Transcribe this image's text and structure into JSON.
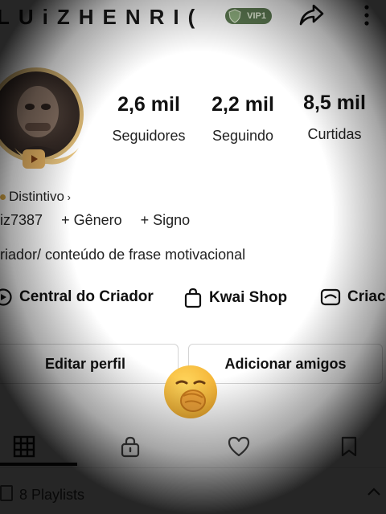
{
  "header": {
    "profile_name": "LUiZHENRI(",
    "vip_label": "VIP1"
  },
  "stats": [
    {
      "value": "2,6 mil",
      "label": "Seguidores"
    },
    {
      "value": "2,2 mil",
      "label": "Seguindo"
    },
    {
      "value": "8,5 mil",
      "label": "Curtidas"
    }
  ],
  "profile": {
    "badge_label": "Distintivo",
    "user_id": "iz7387",
    "gender_label": "+ Gênero",
    "sign_label": "+ Signo",
    "bio": "riador/ conteúdo de frase motivacional"
  },
  "shortcuts": [
    {
      "label": "Central do Criador",
      "icon": "creator-center-icon"
    },
    {
      "label": "Kwai Shop",
      "icon": "shopping-bag-icon"
    },
    {
      "label": "Criac",
      "icon": "create-icon"
    }
  ],
  "buttons": {
    "edit_profile": "Editar perfil",
    "add_friends": "Adicionar amigos"
  },
  "tabs": [
    {
      "name": "grid",
      "icon": "grid-icon",
      "active": true
    },
    {
      "name": "private",
      "icon": "lock-icon",
      "active": false
    },
    {
      "name": "likes",
      "icon": "heart-icon",
      "active": false
    },
    {
      "name": "saved",
      "icon": "bookmark-icon",
      "active": false
    }
  ],
  "playlists": {
    "label": "8 Playlists"
  },
  "colors": {
    "vip_badge": "#5d7a52",
    "avatar_frame": "#d9b774",
    "tab_underline": "#111111"
  }
}
